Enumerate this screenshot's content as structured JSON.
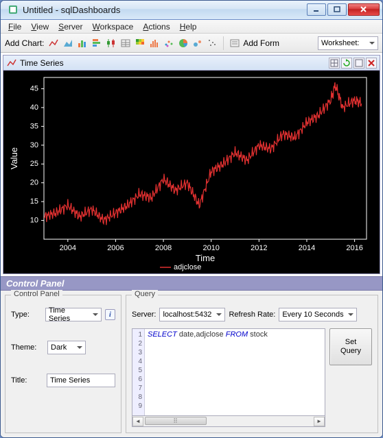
{
  "window": {
    "title": "Untitled - sqlDashboards"
  },
  "menu": [
    "File",
    "View",
    "Server",
    "Workspace",
    "Actions",
    "Help"
  ],
  "toolbar": {
    "add_chart_label": "Add Chart:",
    "add_form_label": "Add Form",
    "worksheet_label": "Worksheet:"
  },
  "chart_panel": {
    "title": "Time Series"
  },
  "chart_data": {
    "type": "line",
    "title": "",
    "xlabel": "Time",
    "ylabel": "Value",
    "xlim": [
      2003,
      2016.5
    ],
    "ylim": [
      5,
      48
    ],
    "xticks": [
      2004,
      2006,
      2008,
      2010,
      2012,
      2014,
      2016
    ],
    "yticks": [
      10,
      15,
      20,
      25,
      30,
      35,
      40,
      45
    ],
    "series": [
      {
        "name": "adjclose",
        "color": "#e03030",
        "x": [
          2003,
          2003.5,
          2004,
          2004.5,
          2005,
          2005.5,
          2006,
          2006.5,
          2007,
          2007.5,
          2008,
          2008.5,
          2009,
          2009.5,
          2010,
          2010.5,
          2011,
          2011.5,
          2012,
          2012.5,
          2013,
          2013.5,
          2014,
          2014.5,
          2015,
          2015.2,
          2015.5,
          2016,
          2016.3
        ],
        "y": [
          11,
          12,
          14,
          11,
          13,
          10,
          12,
          14,
          17,
          16,
          21,
          18,
          20,
          14,
          23,
          25,
          28,
          26,
          30,
          29,
          33,
          32,
          36,
          38,
          42,
          46,
          40,
          42,
          41
        ]
      }
    ],
    "legend_position": "bottom"
  },
  "control_panel": {
    "header": "Control Panel",
    "left_legend": "Control Panel",
    "type_label": "Type:",
    "type_value": "Time Series",
    "theme_label": "Theme:",
    "theme_value": "Dark",
    "title_label": "Title:",
    "title_value": "Time Series"
  },
  "query_panel": {
    "legend": "Query",
    "server_label": "Server:",
    "server_value": "localhost:5432",
    "refresh_label": "Refresh Rate:",
    "refresh_value": "Every 10 Seconds",
    "button_label": "Set\nQuery",
    "line_numbers": [
      1,
      2,
      3,
      4,
      5,
      6,
      7,
      8,
      9
    ],
    "sql": {
      "select": "SELECT",
      "cols": " date,adjclose ",
      "from": "FROM",
      "table": " stock"
    }
  }
}
